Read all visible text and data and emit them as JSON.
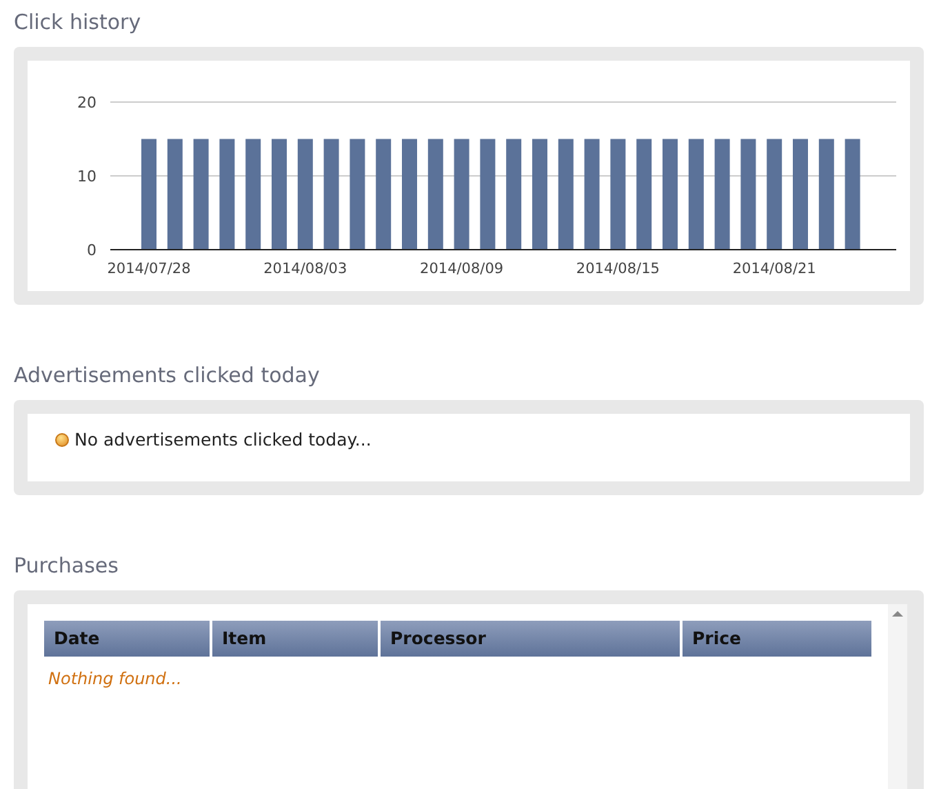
{
  "click_history": {
    "title": "Click history",
    "chart_data": {
      "type": "bar",
      "categories": [
        "2014/07/28",
        null,
        null,
        null,
        null,
        null,
        "2014/08/03",
        null,
        null,
        null,
        null,
        null,
        "2014/08/09",
        null,
        null,
        null,
        null,
        null,
        "2014/08/15",
        null,
        null,
        null,
        null,
        null,
        "2014/08/21",
        null,
        null,
        null
      ],
      "series": [
        {
          "color": "#5b7299",
          "values": [
            15,
            15,
            15,
            15,
            15,
            15,
            15,
            15,
            15,
            15,
            15,
            15,
            15,
            15,
            15,
            15,
            15,
            15,
            15,
            15,
            15,
            15,
            15,
            15,
            15,
            15,
            15,
            15
          ]
        }
      ],
      "ylim": [
        0,
        20
      ],
      "yticks": [
        0,
        10,
        20
      ]
    }
  },
  "ads_clicked_today": {
    "title": "Advertisements clicked today",
    "message": "No advertisements clicked today..."
  },
  "purchases": {
    "title": "Purchases",
    "table": {
      "columns": [
        "Date",
        "Item",
        "Processor",
        "Price"
      ],
      "empty_message": "Nothing found..."
    }
  }
}
